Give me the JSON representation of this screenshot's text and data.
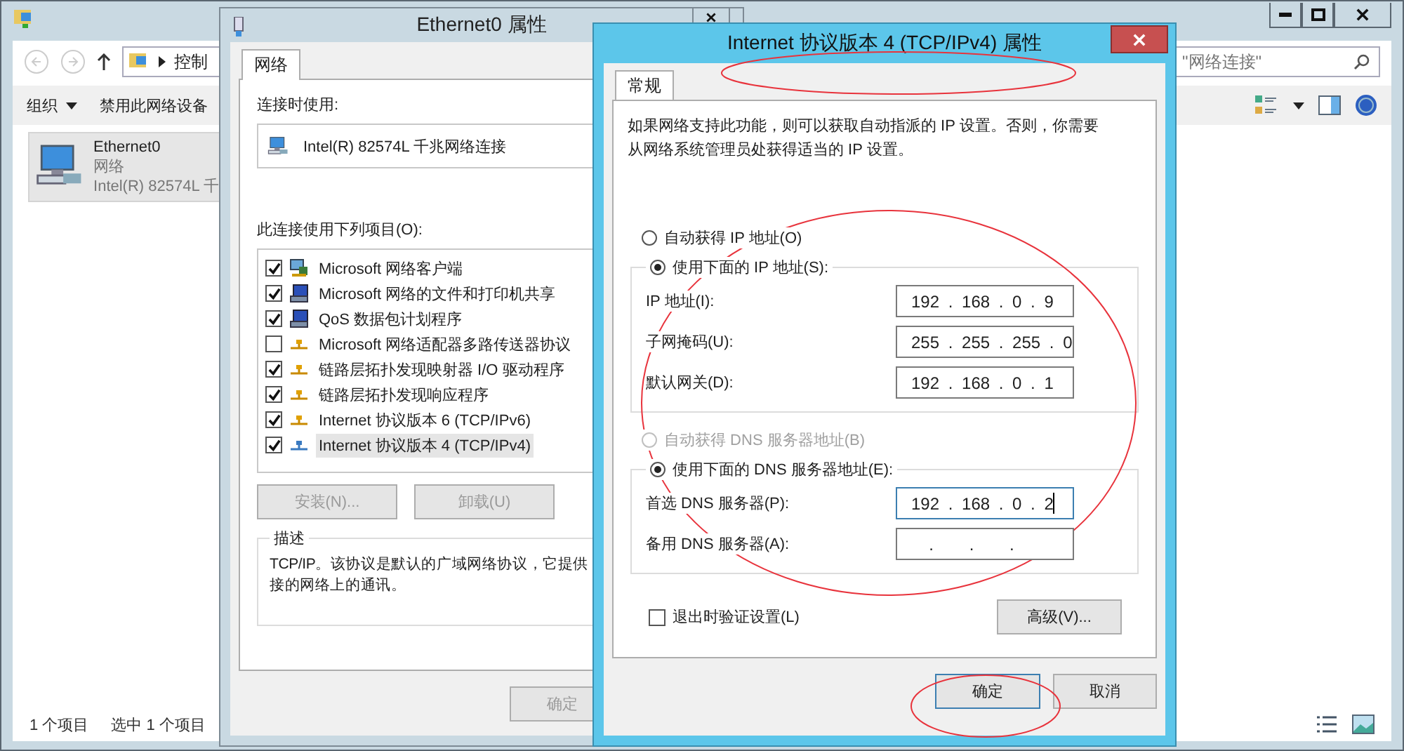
{
  "explorer": {
    "address": "控制",
    "search": {
      "placeholder": "\"网络连接\""
    },
    "toolbar": [
      {
        "label": "组织",
        "dropdown": true
      },
      {
        "label": "禁用此网络设备",
        "dropdown": false
      }
    ],
    "items": [
      {
        "name": "Ethernet0",
        "type": "网络",
        "device": "Intel(R) 82574L 千",
        "selected": true
      }
    ],
    "status_bar": {
      "count": "1 个项目",
      "selection": "选中 1 个项目"
    }
  },
  "ethernet_dialog": {
    "title": "Ethernet0 属性",
    "tabs": [
      {
        "label": "网络",
        "selected": true
      }
    ],
    "connect_using_label": "连接时使用:",
    "adapter": "Intel(R) 82574L 千兆网络连接",
    "components_label": "此连接使用下列项目(O):",
    "components": [
      {
        "label": "Microsoft 网络客户端",
        "checked": true,
        "kind": "client",
        "selected": false
      },
      {
        "label": "Microsoft 网络的文件和打印机共享",
        "checked": true,
        "kind": "service",
        "selected": false
      },
      {
        "label": "QoS 数据包计划程序",
        "checked": true,
        "kind": "service",
        "selected": false
      },
      {
        "label": "Microsoft 网络适配器多路传送器协议",
        "checked": false,
        "kind": "protocol",
        "selected": false
      },
      {
        "label": "链路层拓扑发现映射器 I/O 驱动程序",
        "checked": true,
        "kind": "protocol",
        "selected": false
      },
      {
        "label": "链路层拓扑发现响应程序",
        "checked": true,
        "kind": "protocol",
        "selected": false
      },
      {
        "label": "Internet 协议版本 6 (TCP/IPv6)",
        "checked": true,
        "kind": "protocol",
        "selected": false
      },
      {
        "label": "Internet 协议版本 4 (TCP/IPv4)",
        "checked": true,
        "kind": "protocol",
        "selected": true
      }
    ],
    "buttons": [
      {
        "label": "安装(N)...",
        "disabled": true
      },
      {
        "label": "卸载(U)",
        "disabled": true
      }
    ],
    "description": {
      "title": "描述",
      "lines": [
        "TCP/IP。该协议是默认的广域网络协议，它提供",
        "接的网络上的通讯。"
      ]
    },
    "ok_button": {
      "label": "确定",
      "disabled": true
    }
  },
  "ipv4_dialog": {
    "title": "Internet 协议版本 4 (TCP/IPv4) 属性",
    "tabs": [
      {
        "label": "常规",
        "selected": true
      }
    ],
    "intro": "如果网络支持此功能，则可以获取自动指派的 IP 设置。否则，你需要从网络系统管理员处获得适当的 IP 设置。",
    "ip_mode": [
      {
        "label": "自动获得 IP 地址(O)",
        "selected": false,
        "disabled": false
      },
      {
        "label": "使用下面的 IP 地址(S):",
        "selected": true,
        "disabled": false
      }
    ],
    "ip_fields": [
      {
        "label": "IP 地址(I):",
        "value": "192 . 168 . 0 . 9",
        "focused": false
      },
      {
        "label": "子网掩码(U):",
        "value": "255 . 255 . 255 . 0",
        "focused": false
      },
      {
        "label": "默认网关(D):",
        "value": "192 . 168 . 0 . 1",
        "focused": false
      }
    ],
    "dns_mode": [
      {
        "label": "自动获得 DNS 服务器地址(B)",
        "selected": false,
        "disabled": true
      },
      {
        "label": "使用下面的 DNS 服务器地址(E):",
        "selected": true,
        "disabled": false
      }
    ],
    "dns_fields": [
      {
        "label": "首选 DNS 服务器(P):",
        "value": "192 . 168 . 0 . 2",
        "focused": true
      },
      {
        "label": "备用 DNS 服务器(A):",
        "value": "  .    .    .",
        "focused": false
      }
    ],
    "validate": {
      "label": "退出时验证设置(L)",
      "checked": false
    },
    "advanced_button": "高级(V)...",
    "buttons": [
      {
        "label": "确定",
        "focused": true
      },
      {
        "label": "取消",
        "focused": false
      }
    ]
  }
}
